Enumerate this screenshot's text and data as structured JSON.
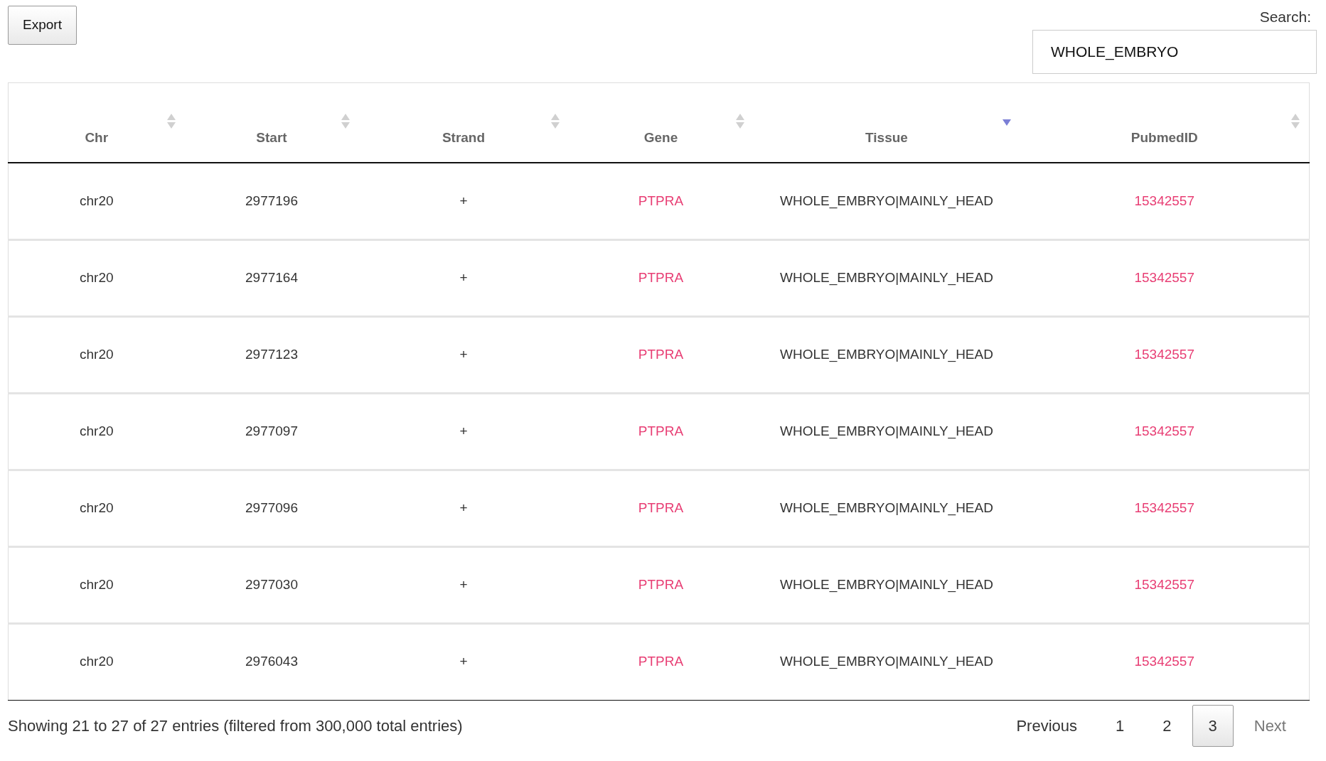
{
  "export_button": "Export",
  "search": {
    "label": "Search:",
    "value": "WHOLE_EMBRYO"
  },
  "table": {
    "columns": [
      {
        "label": "Chr",
        "sorted": false
      },
      {
        "label": "Start",
        "sorted": false
      },
      {
        "label": "Strand",
        "sorted": false
      },
      {
        "label": "Gene",
        "sorted": false
      },
      {
        "label": "Tissue",
        "sorted": true,
        "descending": true
      },
      {
        "label": "PubmedID",
        "sorted": false
      }
    ],
    "rows": [
      {
        "chr": "chr20",
        "start": "2977196",
        "strand": "+",
        "gene": "PTPRA",
        "tissue": "WHOLE_EMBRYO|MAINLY_HEAD",
        "pubmed": "15342557"
      },
      {
        "chr": "chr20",
        "start": "2977164",
        "strand": "+",
        "gene": "PTPRA",
        "tissue": "WHOLE_EMBRYO|MAINLY_HEAD",
        "pubmed": "15342557"
      },
      {
        "chr": "chr20",
        "start": "2977123",
        "strand": "+",
        "gene": "PTPRA",
        "tissue": "WHOLE_EMBRYO|MAINLY_HEAD",
        "pubmed": "15342557"
      },
      {
        "chr": "chr20",
        "start": "2977097",
        "strand": "+",
        "gene": "PTPRA",
        "tissue": "WHOLE_EMBRYO|MAINLY_HEAD",
        "pubmed": "15342557"
      },
      {
        "chr": "chr20",
        "start": "2977096",
        "strand": "+",
        "gene": "PTPRA",
        "tissue": "WHOLE_EMBRYO|MAINLY_HEAD",
        "pubmed": "15342557"
      },
      {
        "chr": "chr20",
        "start": "2977030",
        "strand": "+",
        "gene": "PTPRA",
        "tissue": "WHOLE_EMBRYO|MAINLY_HEAD",
        "pubmed": "15342557"
      },
      {
        "chr": "chr20",
        "start": "2976043",
        "strand": "+",
        "gene": "PTPRA",
        "tissue": "WHOLE_EMBRYO|MAINLY_HEAD",
        "pubmed": "15342557"
      }
    ]
  },
  "info": "Showing 21 to 27 of 27 entries (filtered from 300,000 total entries)",
  "pagination": {
    "previous": {
      "label": "Previous",
      "disabled": false
    },
    "pages": [
      {
        "label": "1",
        "selected": false
      },
      {
        "label": "2",
        "selected": false
      },
      {
        "label": "3",
        "selected": true
      }
    ],
    "next": {
      "label": "Next",
      "disabled": true
    }
  }
}
